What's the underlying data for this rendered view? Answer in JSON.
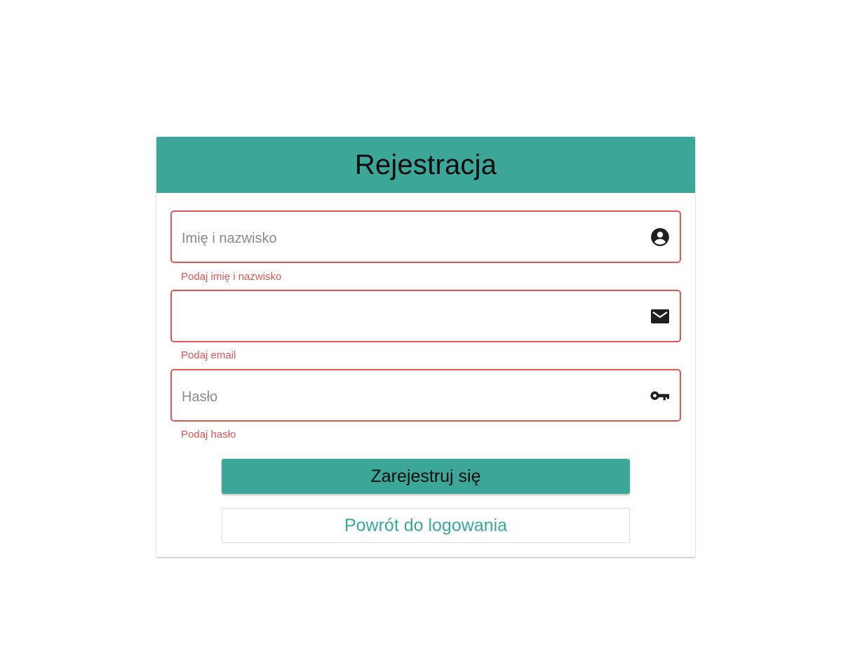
{
  "form": {
    "title": "Rejestracja",
    "fields": [
      {
        "name": "full-name",
        "placeholder": "Imię i nazwisko",
        "value": "",
        "error": "Podaj imię i nazwisko",
        "icon": "account-circle-icon"
      },
      {
        "name": "email",
        "placeholder": "",
        "value": "",
        "error": "Podaj email",
        "icon": "mail-icon"
      },
      {
        "name": "password",
        "placeholder": "Hasło",
        "value": "",
        "error": "Podaj hasło",
        "icon": "key-icon"
      }
    ],
    "submit_label": "Zarejestruj się",
    "back_label": "Powrót do logowania"
  },
  "colors": {
    "accent": "#3ca699",
    "error": "#e05656",
    "icon": "#1f1f1f"
  }
}
